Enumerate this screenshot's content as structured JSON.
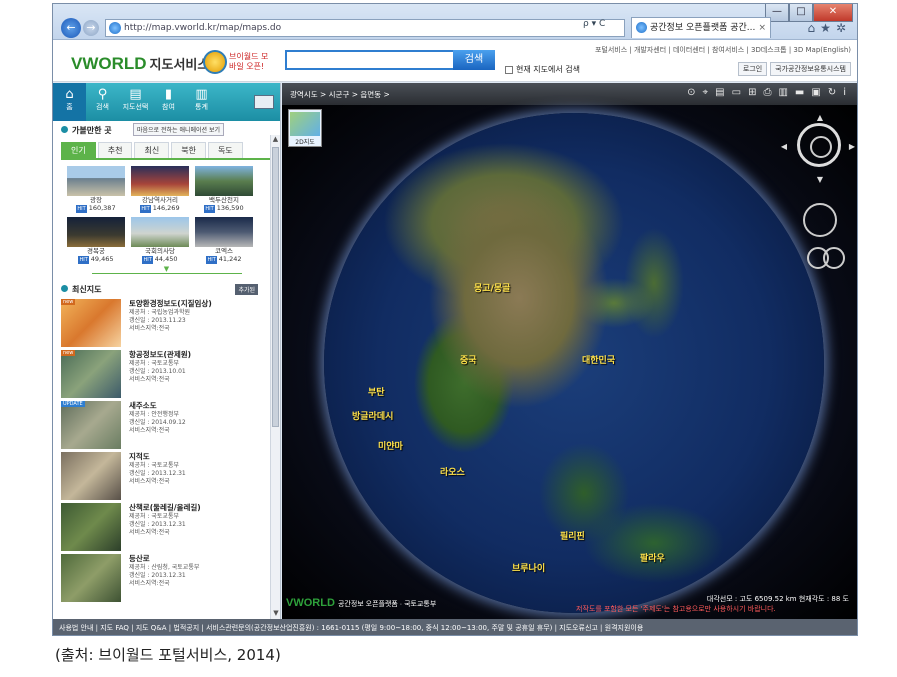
{
  "browser": {
    "address": "http://map.vworld.kr/map/maps.do",
    "address_tools": "ρ ▾ C",
    "tab_title": "공간정보 오픈플랫폼 공간...",
    "tab_close": "×",
    "window_controls": {
      "minimize": "—",
      "maximize": "□",
      "close": "✕"
    },
    "icons": [
      "home-icon",
      "favorites-star-icon",
      "settings-gear-icon"
    ]
  },
  "header": {
    "logo_text": "VWORLD",
    "service_name": "지도서비스",
    "promo": "브이월드 모바일 오픈!",
    "search_placeholder": "",
    "search_button": "검색",
    "checkbox_label": "현재 지도에서 검색",
    "top_links": "포털서비스 | 개발자센터 | 데이터센터 | 참여서비스 | 3D데스크톱 | 3D Map(English)",
    "login": "로그인",
    "agency": "국가공간정보유통시스템"
  },
  "menu": {
    "items": [
      {
        "label": "홈",
        "icon": "home-icon"
      },
      {
        "label": "검색",
        "icon": "search-icon"
      },
      {
        "label": "지도선택",
        "icon": "layers-icon"
      },
      {
        "label": "참여",
        "icon": "participate-icon"
      },
      {
        "label": "통계",
        "icon": "chart-icon"
      }
    ]
  },
  "places": {
    "title": "가볼만한 곳",
    "animation_button": "마음으로 전하는 애니메이션 보기",
    "tabs": [
      "인기",
      "추천",
      "최신",
      "북한",
      "독도"
    ],
    "active_tab": "인기",
    "items": [
      {
        "name": "광장",
        "count": "160,387"
      },
      {
        "name": "강남역사거리",
        "count": "146,269"
      },
      {
        "name": "백두산천지",
        "count": "136,590"
      },
      {
        "name": "경복궁",
        "count": "49,465"
      },
      {
        "name": "국회의사당",
        "count": "44,450"
      },
      {
        "name": "코엑스",
        "count": "41,242"
      }
    ],
    "hit_badge": "HIT"
  },
  "recent": {
    "title": "최신지도",
    "more": "추가된",
    "items": [
      {
        "tag": "new",
        "title": "토양환경정보도(지질임상)",
        "provider": "제공처 : 국립농업과학원",
        "updated": "갱신일 : 2013.11.23",
        "region": "서비스지역:전국"
      },
      {
        "tag": "new",
        "title": "항공정보도(관제원)",
        "provider": "제공처 : 국토교통부",
        "updated": "갱신일 : 2013.10.01",
        "region": "서비스지역:전국"
      },
      {
        "tag": "UPDATE",
        "title": "새주소도",
        "provider": "제공처 : 안전행정부",
        "updated": "갱신일 : 2014.09.12",
        "region": "서비스지역:전국"
      },
      {
        "tag": "",
        "title": "지적도",
        "provider": "제공처 : 국토교통부",
        "updated": "갱신일 : 2013.12.31",
        "region": "서비스지역:전국"
      },
      {
        "tag": "",
        "title": "산책로(둘레길/올레길)",
        "provider": "제공처 : 국토교통부",
        "updated": "갱신일 : 2013.12.31",
        "region": "서비스지역:전국"
      },
      {
        "tag": "",
        "title": "등산로",
        "provider": "제공처 : 산림청, 국토교통부",
        "updated": "갱신일 : 2013.12.31",
        "region": "서비스지역:전국"
      }
    ]
  },
  "map": {
    "breadcrumb": "광역시도 >  시군구 >  읍면동 >",
    "toolbar_icons": [
      "location-icon",
      "measure-icon",
      "layer-icon",
      "roadview-icon",
      "save-icon",
      "print-icon",
      "split-icon",
      "legend-icon",
      "fullscreen-icon",
      "refresh-icon",
      "info-icon"
    ],
    "view_2d": "2D지도",
    "labels": [
      {
        "text": "몽고/몽골"
      },
      {
        "text": "중국"
      },
      {
        "text": "대한민국"
      },
      {
        "text": "부탄"
      },
      {
        "text": "방글라데시"
      },
      {
        "text": "미얀마"
      },
      {
        "text": "라오스"
      },
      {
        "text": "필리핀"
      },
      {
        "text": "브루나이"
      },
      {
        "text": "팔라우"
      }
    ],
    "footer_logo": "VWORLD",
    "footer_text": "공간정보 오픈플랫폼 · 국토교통부",
    "warning": "저작도를 포함한 모든 '주제도'는 참고용으로만 사용하시기 바랍니다.",
    "scale": "대각선모 : 고도 6509.52 km  현재각도 : 88 도"
  },
  "statusbar": {
    "text": "사용법 안내 | 지도 FAQ | 지도 Q&A | 법적공지 | 서비스관련문의(공간정보산업진흥원) : 1661-0115 (평일 9:00~18:00, 중식 12:00~13:00, 주말 및 공휴일 휴무) | 지도오류신고 | 원격지원이용"
  },
  "caption": "(출처: 브이월드 포털서비스, 2014)"
}
